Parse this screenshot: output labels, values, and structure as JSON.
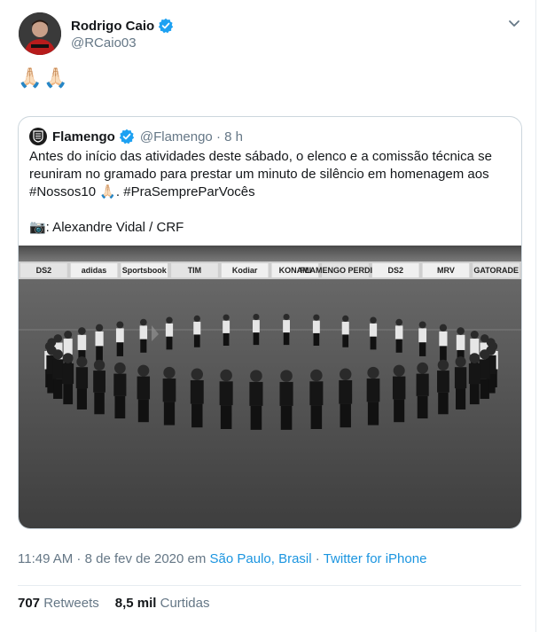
{
  "author": {
    "name": "Rodrigo Caio",
    "handle": "@RCaio03",
    "verified_color": "#1da1f2"
  },
  "tweet": {
    "emoji": [
      "🙏🏻",
      "🙏🏻"
    ]
  },
  "quoted": {
    "name": "Flamengo",
    "handle_time": "@Flamengo · 8 h",
    "text": {
      "line1": "Antes do início das atividades deste sábado, o elenco e a comissão técnica se reuniram no gramado para prestar um minuto de silêncio em homenagem aos #Nossos10 🙏🏻. #PraSempreParVocês",
      "credit": "📷: Alexandre Vidal / CRF"
    },
    "photo": {
      "sponsor_boards": [
        "DS2",
        "adidas",
        "Sportsbook",
        "TIM",
        "Kodiar",
        "KONAMI",
        "FLAMENGO PERDIGÃO",
        "DS2",
        "MRV",
        "GATORADE"
      ]
    }
  },
  "meta": {
    "time_date": "11:49 AM · 8 de fev de 2020 em",
    "place": "São Paulo, Brasil",
    "separator": "·",
    "source": "Twitter for iPhone"
  },
  "stats": {
    "retweets_count": "707",
    "retweets_label": "Retweets",
    "likes_count": "8,5 mil",
    "likes_label": "Curtidas"
  },
  "colors": {
    "link": "#1b95e0",
    "secondary_text": "#657786",
    "border": "#ccd6dd"
  }
}
